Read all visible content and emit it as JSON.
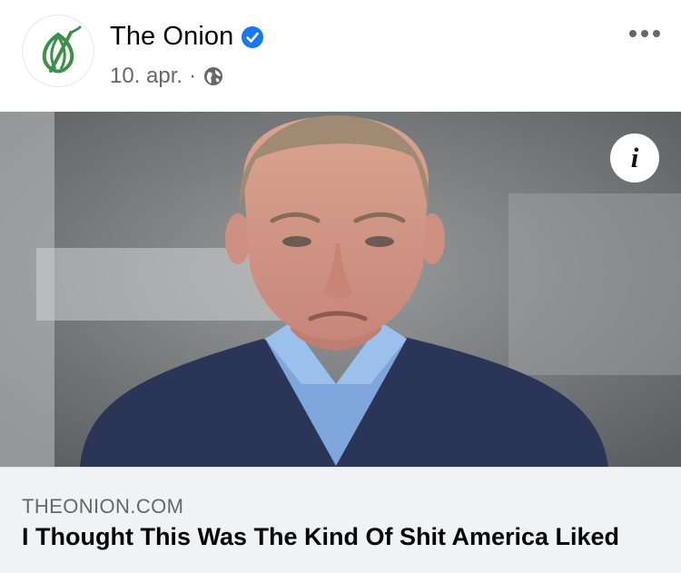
{
  "post": {
    "page_name": "The Onion",
    "date": "10. apr.",
    "separator": "·",
    "verified_icon": "verified-badge-icon",
    "privacy_icon": "globe-icon",
    "more_icon": "more-options-icon"
  },
  "link_preview": {
    "domain": "THEONION.COM",
    "title": "I Thought This Was The Kind Of Shit America Liked",
    "info_label": "i"
  },
  "colors": {
    "brand_green": "#3e8f4a",
    "verified_blue": "#1877f2",
    "secondary_text": "#65676b",
    "footer_bg": "#f0f2f5"
  }
}
